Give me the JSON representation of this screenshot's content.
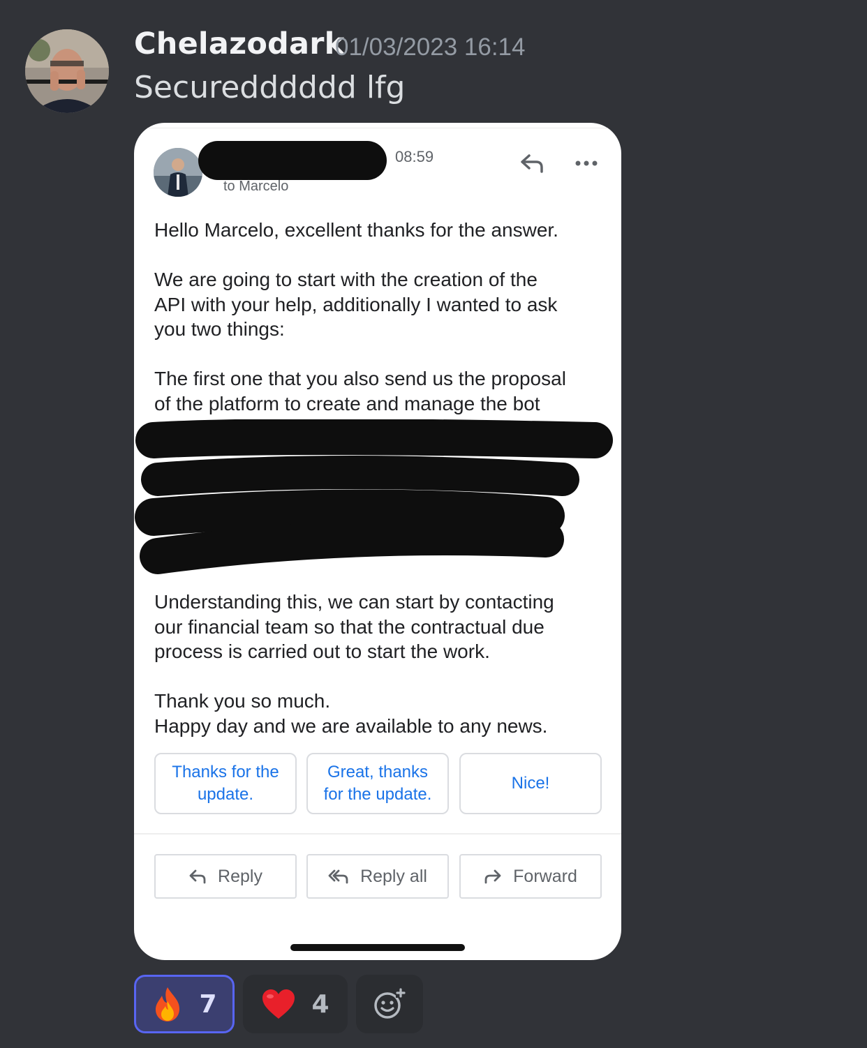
{
  "message": {
    "author": "Chelazodark",
    "timestamp": "01/03/2023 16:14",
    "text": "Securedddddd lfg"
  },
  "email": {
    "time": "08:59",
    "recipient": "to Marcelo",
    "greeting": "Hello Marcelo, excellent thanks for the answer.",
    "paragraph1": "We are going to start with the creation of the\nAPI with your help, additionally I wanted to ask\nyou two things:",
    "paragraph2": "The first one that you also send us the proposal\nof the platform to create and manage the bot",
    "paragraph3": "Understanding this, we can start by contacting\nour financial team so that the contractual due\nprocess is carried out to start the work.",
    "closing": "Thank you so much.\nHappy day and we are available to any news.",
    "smart_replies": [
      "Thanks for the update.",
      "Great, thanks for the update.",
      "Nice!"
    ],
    "actions": {
      "reply": "Reply",
      "reply_all": "Reply all",
      "forward": "Forward"
    }
  },
  "reactions": [
    {
      "emoji": "🔥",
      "count": "7",
      "active": true
    },
    {
      "emoji": "❤️",
      "count": "4",
      "active": false
    }
  ],
  "colors": {
    "background": "#313338",
    "author": "#f2f3f5",
    "timestamp": "#949ba4",
    "link_blue": "#1a73e8",
    "reaction_active_border": "#5865f2"
  }
}
